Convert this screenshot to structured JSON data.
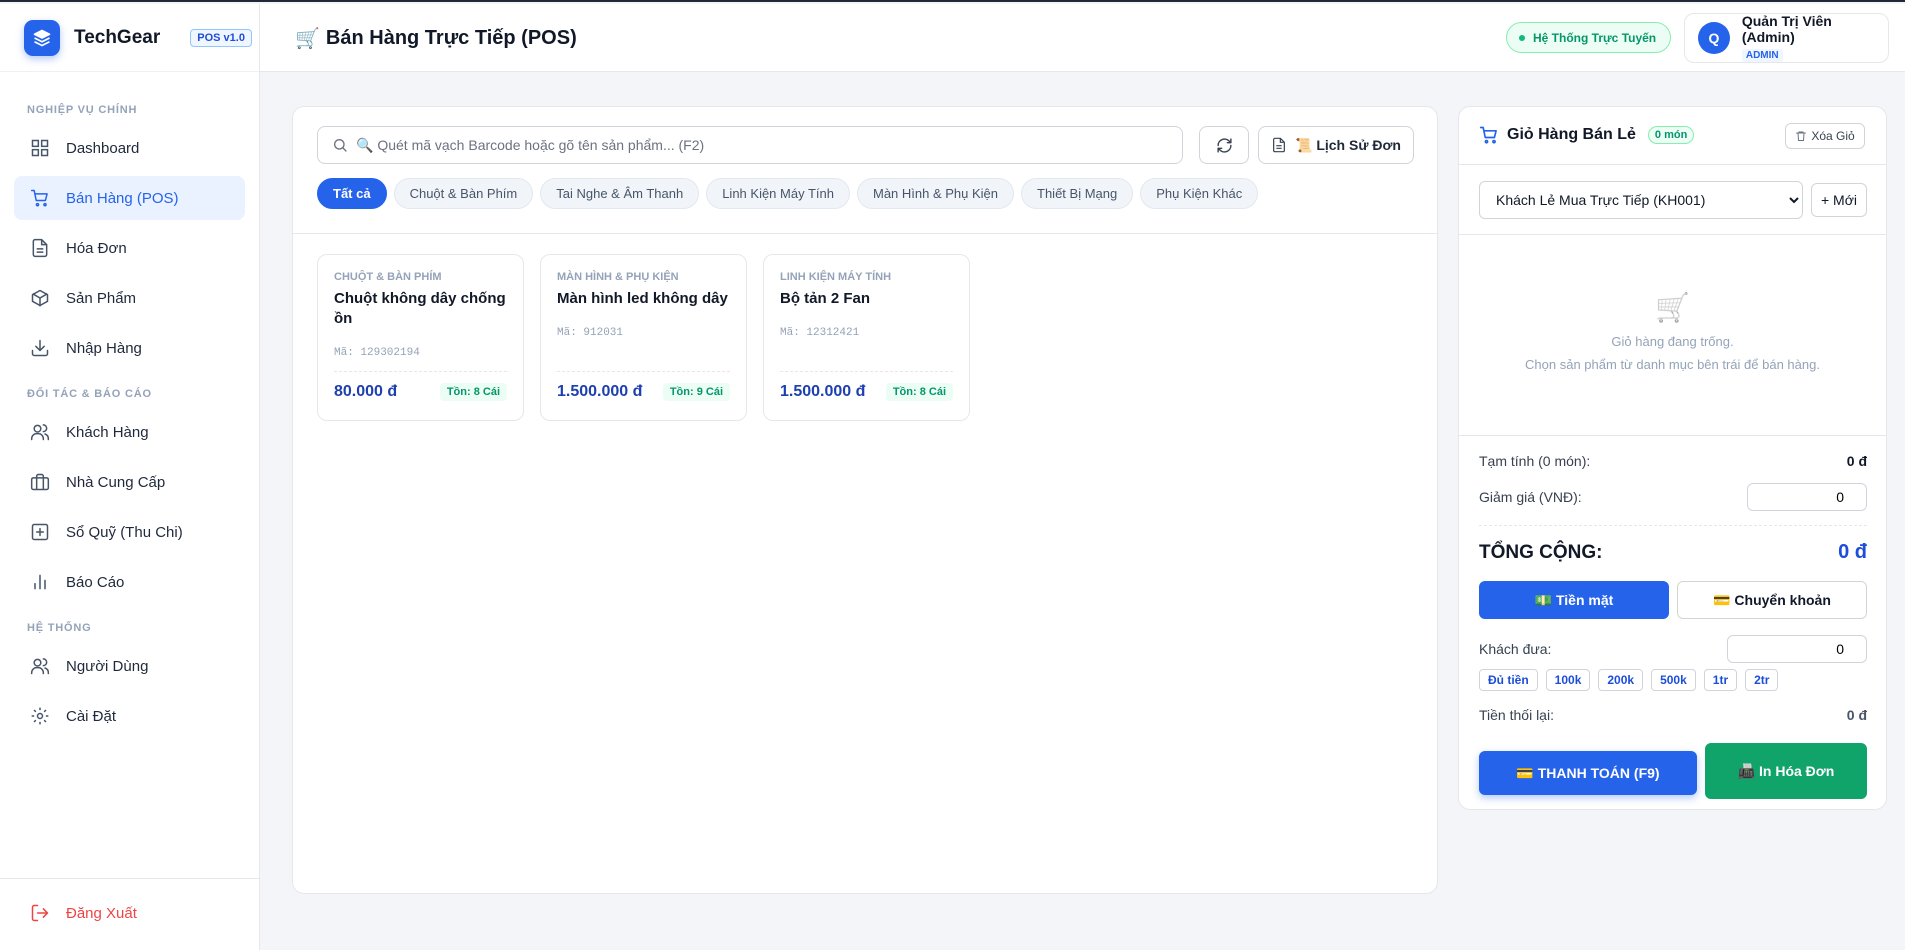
{
  "brand": {
    "name": "TechGear",
    "version": "POS v1.0"
  },
  "sidebar": {
    "section_main": "NGHIỆP VỤ CHÍNH",
    "section_partners": "ĐỐI TÁC & BÁO CÁO",
    "section_system": "HỆ THỐNG",
    "items": [
      {
        "label": "Dashboard",
        "icon": "dashboard-icon"
      },
      {
        "label": "Bán Hàng (POS)",
        "icon": "cart-icon",
        "active": true
      },
      {
        "label": "Hóa Đơn",
        "icon": "document-icon"
      },
      {
        "label": "Sản Phẩm",
        "icon": "box-icon"
      },
      {
        "label": "Nhập Hàng",
        "icon": "download-icon"
      },
      {
        "label": "Khách Hàng",
        "icon": "users-icon"
      },
      {
        "label": "Nhà Cung Cấp",
        "icon": "briefcase-icon"
      },
      {
        "label": "Sổ Quỹ (Thu Chi)",
        "icon": "plus-square-icon"
      },
      {
        "label": "Báo Cáo",
        "icon": "bar-chart-icon"
      },
      {
        "label": "Người Dùng",
        "icon": "users-icon"
      },
      {
        "label": "Cài Đặt",
        "icon": "gear-icon"
      }
    ],
    "logout": "Đăng Xuất"
  },
  "header": {
    "title": "Bán Hàng Trực Tiếp (POS)",
    "title_icon": "🛒",
    "status": "Hệ Thống Trực Tuyến",
    "user": {
      "initial": "Q",
      "name": "Quản Trị Viên (Admin)",
      "role": "ADMIN"
    }
  },
  "search": {
    "placeholder": "🔍 Quét mã vạch Barcode hoặc gõ tên sản phẩm... (F2)"
  },
  "history_button": "📜 Lịch Sử Đơn",
  "categories": [
    "Tất cả",
    "Chuột & Bàn Phím",
    "Tai Nghe & Âm Thanh",
    "Linh Kiện Máy Tính",
    "Màn Hình & Phụ Kiện",
    "Thiết Bị Mạng",
    "Phụ Kiện Khác"
  ],
  "products": [
    {
      "category": "CHUỘT & BÀN PHÍM",
      "name": "Chuột không dây chống ồn",
      "code": "Mã: 129302194",
      "price": "80.000 đ",
      "stock": "Tồn: 8 Cái"
    },
    {
      "category": "MÀN HÌNH & PHỤ KIỆN",
      "name": "Màn hình led không dây",
      "code": "Mã: 912031",
      "price": "1.500.000 đ",
      "stock": "Tồn: 9 Cái"
    },
    {
      "category": "LINH KIỆN MÁY TÍNH",
      "name": "Bộ tản 2 Fan",
      "code": "Mã: 12312421",
      "price": "1.500.000 đ",
      "stock": "Tồn: 8 Cái"
    }
  ],
  "cart": {
    "title": "Giỏ Hàng Bán Lẻ",
    "count_badge": "0 món",
    "clear_label": "Xóa Giỏ",
    "customer_selected": "Khách Lẻ Mua Trực Tiếp (KH001)",
    "new_customer": "+ Mới",
    "empty_icon": "🛒",
    "empty_line1": "Giỏ hàng đang trống.",
    "empty_line2": "Chọn sản phẩm từ danh mục bên trái để bán hàng.",
    "subtotal_label": "Tạm tính (0 món):",
    "subtotal_value": "0 đ",
    "discount_label": "Giảm giá (VNĐ):",
    "discount_value": "0",
    "total_label": "TỔNG CỘNG:",
    "total_value": "0 đ",
    "pay_cash": "💵 Tiền mặt",
    "pay_transfer": "💳 Chuyển khoản",
    "received_label": "Khách đưa:",
    "received_value": "0",
    "quick_amounts": [
      "Đủ tiền",
      "100k",
      "200k",
      "500k",
      "1tr",
      "2tr"
    ],
    "change_label": "Tiền thối lại:",
    "change_value": "0 đ",
    "checkout": "💳 THANH TOÁN (F9)",
    "print": "📠 In Hóa Đơn"
  },
  "colors": {
    "accent": "#2563eb",
    "success": "#10a36a",
    "danger": "#ef4444"
  }
}
